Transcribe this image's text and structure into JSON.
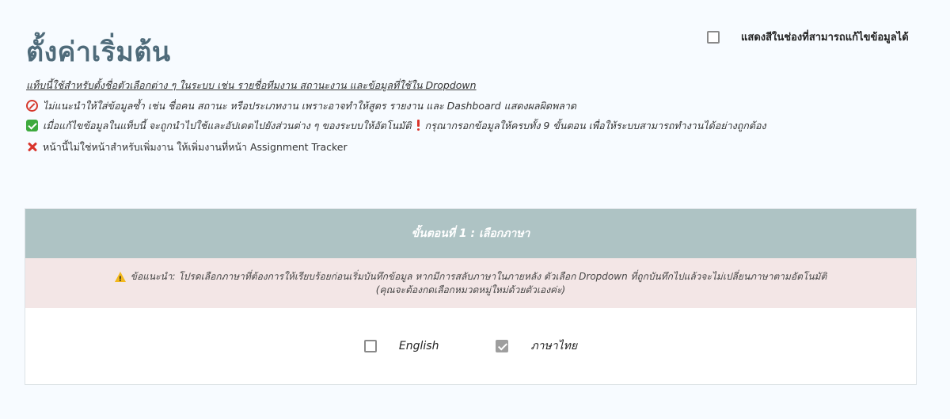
{
  "page": {
    "title": "ตั้งค่าเริ่มต้น"
  },
  "highlight_toggle": {
    "label": "แสดงสีในช่องที่สามารถแก้ไขข้อมูลได้",
    "checked": false
  },
  "notes": {
    "intro": "แท็บนี้ใช้สำหรับตั้งชื่อตัวเลือกต่าง ๆ ในระบบ เช่น รายชื่อทีมงาน สถานะงาน และข้อมูลที่ใช้ใน Dropdown",
    "warning": "ไม่แนะนำให้ใส่ข้อมูลซ้ำ เช่น ชื่อคน สถานะ หรือประเภทงาน เพราะอาจทำให้สูตร รายงาน และ Dashboard แสดงผลผิดพลาด",
    "auto_sync": "เมื่อแก้ไขข้อมูลในแท็บนี้ จะถูกนำไปใช้และอัปเดตไปยังส่วนต่าง ๆ ของระบบให้อัตโนมัติ",
    "complete_steps": "กรุณากรอกข้อมูลให้ครบทั้ง 9 ขั้นตอน เพื่อให้ระบบสามารถทำงานได้อย่างถูกต้อง",
    "not_for_tasks": "หน้านี้ไม่ใช่หน้าสำหรับเพิ่มงาน ให้เพิ่มงานที่หน้า Assignment Tracker"
  },
  "step1": {
    "header": "ขั้นตอนที่ 1 : เลือกภาษา",
    "advice_line1": "ข้อแนะนำ: โปรดเลือกภาษาที่ต้องการให้เรียบร้อยก่อนเริ่มบันทึกข้อมูล หากมีการสลับภาษาในภายหลัง ตัวเลือก Dropdown ที่ถูกบันทึกไปแล้วจะไม่เปลี่ยนภาษาตามอัตโนมัติ",
    "advice_line2": "(คุณจะต้องกดเลือกหมวดหมู่ใหม่ด้วยตัวเองค่ะ)",
    "options": [
      {
        "label": "English",
        "checked": false
      },
      {
        "label": "ภาษาไทย",
        "checked": true
      }
    ]
  },
  "colors": {
    "title": "#4f6b7a",
    "header_bg": "#aec3c4",
    "advice_bg": "#f3e6e6",
    "page_bg": "#f7fbff"
  },
  "icons": {
    "warning_note": "no-entry-icon",
    "auto_sync": "check-mark-icon",
    "complete_steps": "exclamation-icon",
    "not_for_tasks": "cross-mark-icon",
    "advice": "warning-icon"
  }
}
